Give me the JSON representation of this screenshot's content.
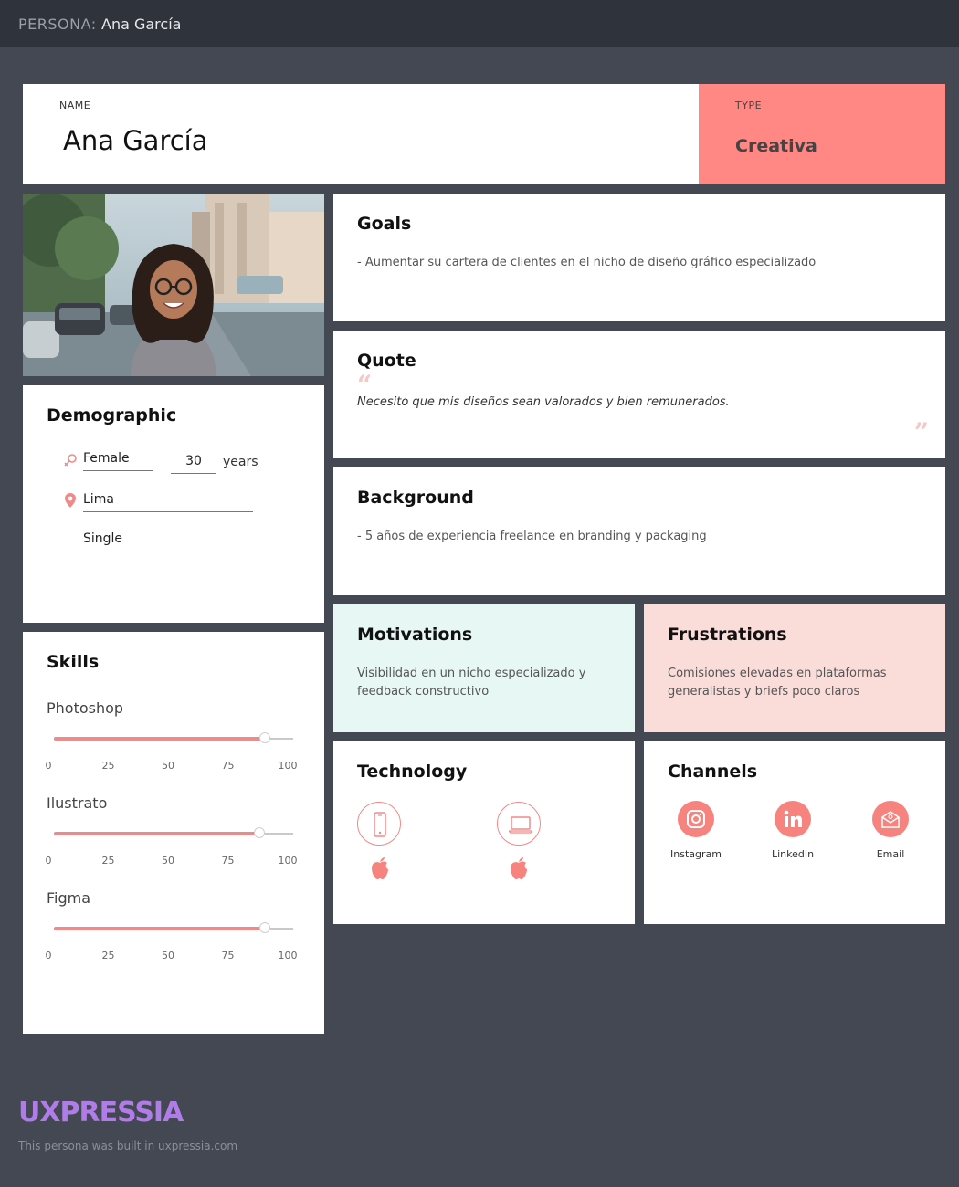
{
  "header": {
    "prefix": "PERSONA:",
    "persona_name": "Ana García"
  },
  "name_card": {
    "label": "NAME",
    "value": "Ana García"
  },
  "type_card": {
    "label": "TYPE",
    "value": "Creativa"
  },
  "demographic": {
    "title": "Demographic",
    "gender": "Female",
    "age": "30",
    "age_unit": "years",
    "location": "Lima",
    "status": "Single"
  },
  "skills": {
    "title": "Skills",
    "ticks": [
      "0",
      "25",
      "50",
      "75",
      "100"
    ],
    "items": [
      {
        "name": "Photoshop",
        "level": 88
      },
      {
        "name": "Ilustrato",
        "level": 86
      },
      {
        "name": "Figma",
        "level": 88
      }
    ]
  },
  "goals": {
    "title": "Goals",
    "text": "- Aumentar su cartera de clientes en el nicho de diseño gráfico especializado"
  },
  "quote": {
    "title": "Quote",
    "text": "Necesito que mis diseños sean valorados y bien remunerados.",
    "open_mark": "“",
    "close_mark": "”"
  },
  "background": {
    "title": "Background",
    "text": "- 5 años de experiencia freelance en branding y packaging"
  },
  "motivations": {
    "title": "Motivations",
    "line1": "Visibilidad en un nicho especializado y",
    "line2": "feedback constructivo"
  },
  "frustrations": {
    "title": "Frustrations",
    "line1": "Comisiones elevadas en plataformas",
    "line2": "generalistas y briefs poco claros"
  },
  "technology": {
    "title": "Technology",
    "devices": [
      {
        "icon": "smartphone-icon",
        "os_icon": "apple-icon"
      },
      {
        "icon": "laptop-icon",
        "os_icon": "apple-icon"
      }
    ]
  },
  "channels": {
    "title": "Channels",
    "items": [
      {
        "label": "Instagram",
        "icon": "instagram-icon"
      },
      {
        "label": "LinkedIn",
        "icon": "linkedin-icon"
      },
      {
        "label": "Email",
        "icon": "email-icon"
      }
    ]
  },
  "footer": {
    "logo": "UXPRESSIA",
    "built_text": "This persona was built in uxpressia.com"
  },
  "colors": {
    "accent": "#ff8784",
    "motivation_bg": "#e6f7f4",
    "frustration_bg": "#fadcd9",
    "logo": "#b07ce8"
  }
}
